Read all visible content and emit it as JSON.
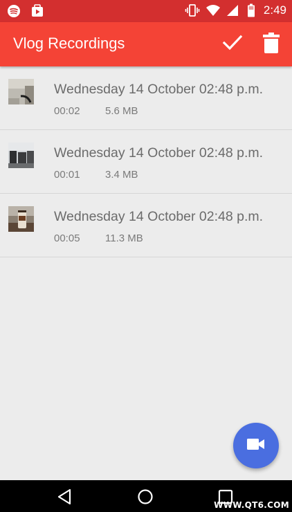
{
  "status_bar": {
    "time": "2:49",
    "left_icons": [
      "spotify-icon",
      "youtube-icon"
    ],
    "right_icons": [
      "vibrate-icon",
      "wifi-icon",
      "signal-icon",
      "battery-icon"
    ],
    "background": "#d32f2f"
  },
  "app_bar": {
    "title": "Vlog Recordings",
    "actions": [
      "check-icon",
      "trash-icon"
    ],
    "background": "#f44336"
  },
  "recordings": [
    {
      "title": "Wednesday 14 October 02:48 p.m.",
      "duration": "00:02",
      "size": "5.6 MB"
    },
    {
      "title": "Wednesday 14 October 02:48 p.m.",
      "duration": "00:01",
      "size": "3.4 MB"
    },
    {
      "title": "Wednesday 14 October 02:48 p.m.",
      "duration": "00:05",
      "size": "11.3 MB"
    }
  ],
  "fab": {
    "icon": "videocam-icon",
    "color": "#4a6ee0"
  },
  "nav_bar": {
    "icons": [
      "back-icon",
      "home-icon",
      "recent-apps-icon"
    ]
  },
  "watermark": "WWW.QT6.COM"
}
